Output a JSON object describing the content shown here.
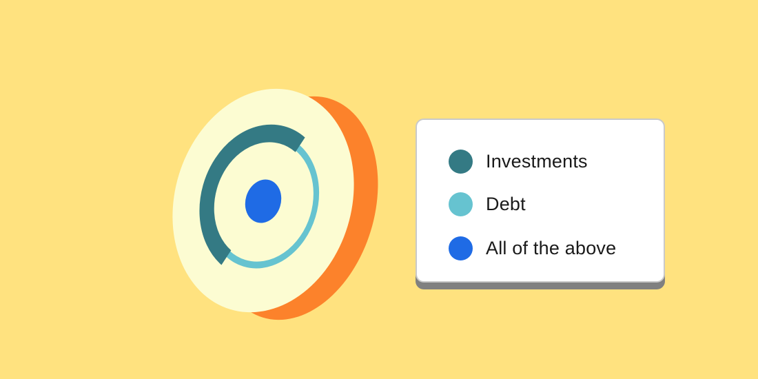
{
  "colors": {
    "background": "#FFE27F",
    "disc_face": "#FCFCD2",
    "disc_edge": "#FC822B",
    "investments": "#347A84",
    "debt": "#66C3D0",
    "all_of_the_above": "#1F6BE5",
    "legend_background": "#FFFFFF",
    "legend_border": "#C9C9C9",
    "legend_shadow": "#808080"
  },
  "legend": {
    "items": [
      {
        "label": "Investments",
        "color": "#347A84"
      },
      {
        "label": "Debt",
        "color": "#66C3D0"
      },
      {
        "label": "All of the above",
        "color": "#1F6BE5"
      }
    ]
  }
}
